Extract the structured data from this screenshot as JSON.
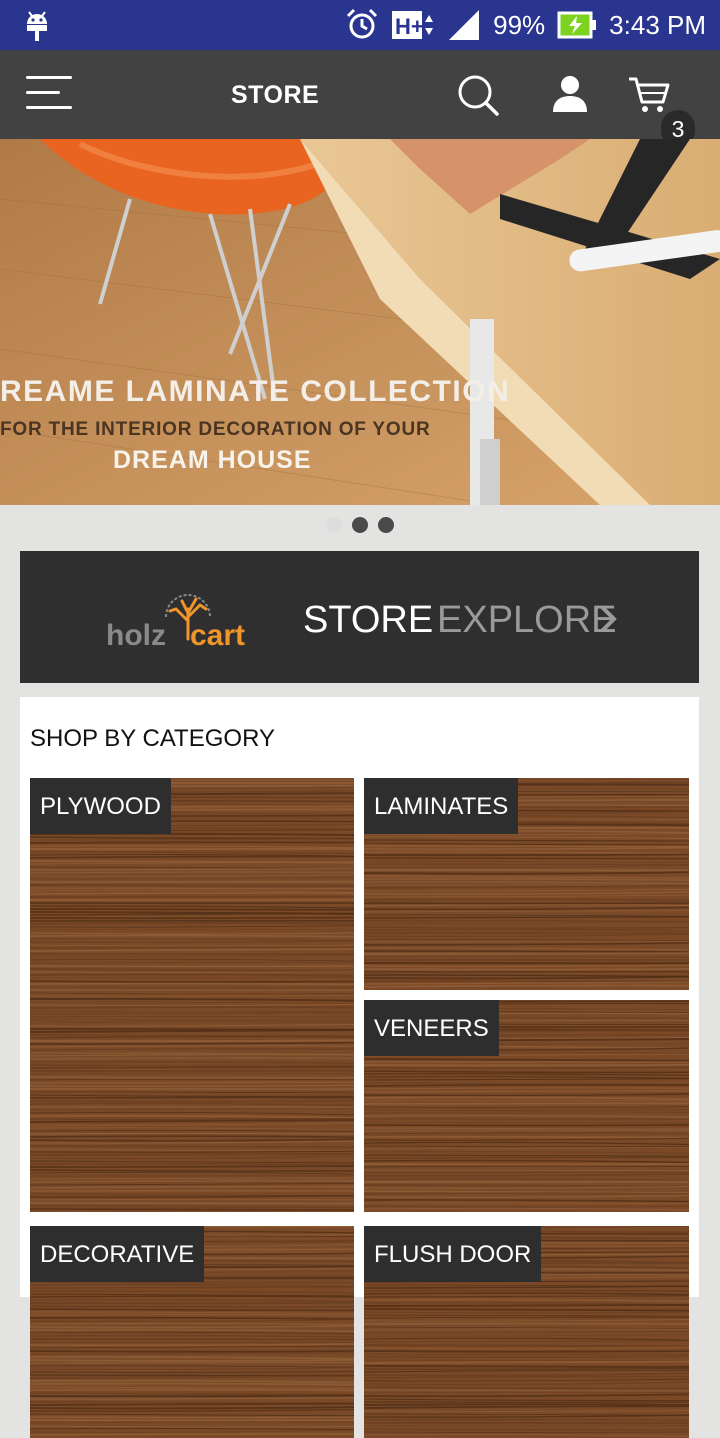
{
  "status_bar": {
    "battery": "99%",
    "time": "3:43 PM",
    "network": "H+"
  },
  "app_bar": {
    "title": "STORE",
    "cart_count": "3"
  },
  "banner": {
    "title": "REAME LAMINATE COLLECTION",
    "subtitle": "FOR THE INTERIOR DECORATION OF YOUR",
    "line3": "DREAM HOUSE",
    "slide_count": 3,
    "active_slide": 2
  },
  "store_panel": {
    "logo_text": "holzcart",
    "store_label": "STORE",
    "explore_label": "EXPLORE"
  },
  "categories": {
    "heading": "SHOP BY CATEGORY",
    "items": [
      {
        "label": "PLYWOOD"
      },
      {
        "label": "LAMINATES"
      },
      {
        "label": "VENEERS"
      },
      {
        "label": "DECORATIVE"
      },
      {
        "label": "FLUSH DOOR"
      }
    ]
  },
  "colors": {
    "status_bar": "#2a3590",
    "app_bar": "#424242",
    "logo_orange": "#f0952a"
  }
}
